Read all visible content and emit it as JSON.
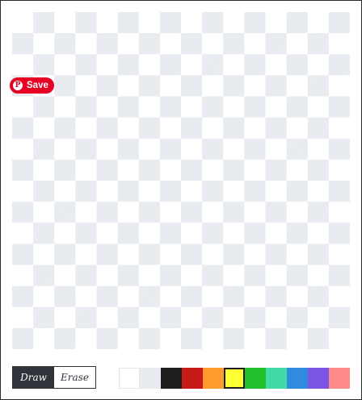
{
  "pinterest": {
    "icon": "pinterest-p-icon",
    "icon_glyph": "P",
    "save_label": "Save",
    "brand_color": "#e60023"
  },
  "canvas": {
    "background": "transparent-checkerboard",
    "checker_colors": [
      "#ffffff",
      "#e8ebef"
    ]
  },
  "toolbar": {
    "modes": [
      {
        "label": "Draw",
        "active": true
      },
      {
        "label": "Erase",
        "active": false
      }
    ],
    "selected_color": "#ffff33",
    "colors": [
      "#ffffff",
      "#e8ebef",
      "#1f1f1f",
      "#c91a1a",
      "#ff9a2e",
      "#ffff33",
      "#22c22e",
      "#44d9a9",
      "#2f8ae0",
      "#7b55e3",
      "#ff8a8a"
    ]
  }
}
